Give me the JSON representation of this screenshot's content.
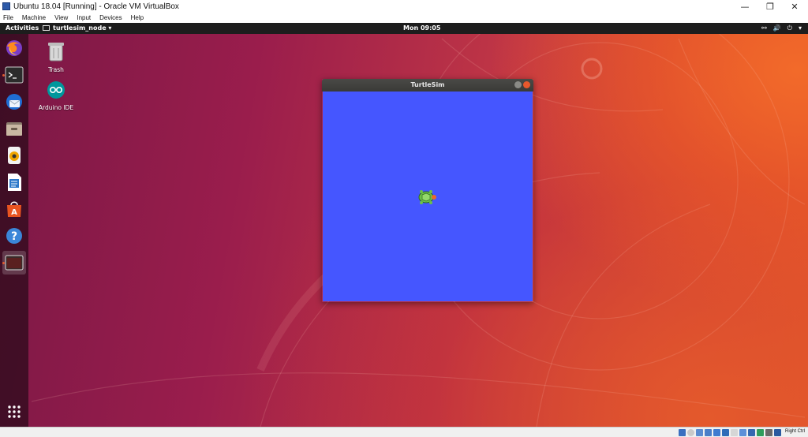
{
  "vbox": {
    "title": "Ubuntu 18.04 [Running] - Oracle VM VirtualBox",
    "window_controls": {
      "minimize": "—",
      "restore": "❐",
      "close": "✕"
    },
    "menu": [
      "File",
      "Machine",
      "View",
      "Input",
      "Devices",
      "Help"
    ],
    "host_key": "Right Ctrl"
  },
  "topbar": {
    "activities": "Activities",
    "app_menu": "turtlesim_node ▾",
    "clock": "Mon 09:05",
    "tray": {
      "network": "⚯",
      "volume": "🔊",
      "power": "⏻",
      "dropdown": "▾"
    }
  },
  "dock": {
    "items": [
      {
        "name": "firefox-icon"
      },
      {
        "name": "terminal-icon"
      },
      {
        "name": "thunderbird-icon"
      },
      {
        "name": "files-icon"
      },
      {
        "name": "rhythmbox-icon"
      },
      {
        "name": "libreoffice-writer-icon"
      },
      {
        "name": "ubuntu-software-icon"
      },
      {
        "name": "help-icon"
      },
      {
        "name": "turtlesim-app-icon"
      }
    ],
    "show_apps": "show-applications-icon"
  },
  "desktop": {
    "icons": [
      {
        "label": "Trash"
      },
      {
        "label": "Arduino IDE"
      }
    ]
  },
  "turtlesim": {
    "title": "TurtleSim",
    "background": "#4556ff"
  }
}
